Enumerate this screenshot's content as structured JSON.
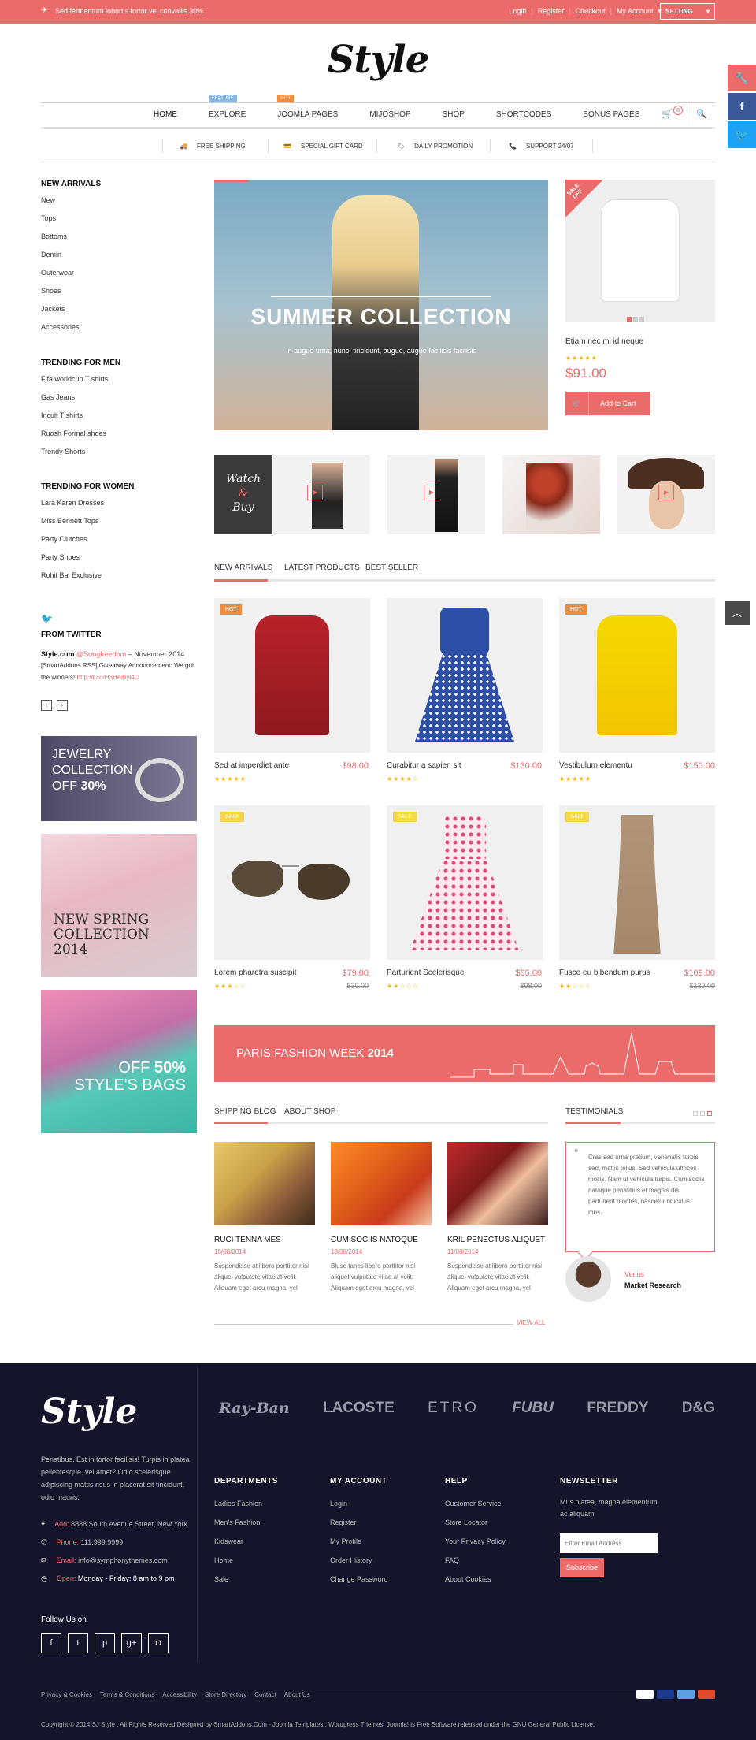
{
  "topbar": {
    "announcement": "Sed fermentum lobortis tortor vel convallis 30%",
    "links": [
      "Login",
      "Register",
      "Checkout",
      "My Account"
    ],
    "setting": "SETTING"
  },
  "logo": "Style",
  "nav": {
    "items": [
      "HOME",
      "EXPLORE",
      "JOOMLA PAGES",
      "MIJOSHOP",
      "SHOP",
      "SHORTCODES",
      "BONUS PAGES"
    ],
    "badge_feature": "FEATURE",
    "badge_hot": "HOT",
    "cart_count": "0"
  },
  "features": [
    "FREE SHIPPING",
    "SPECIAL GIFT CARD",
    "DAILY PROMOTION",
    "SUPPORT 24/07"
  ],
  "sidebar": {
    "new_arrivals_title": "NEW ARRIVALS",
    "new_arrivals": [
      "New",
      "Tops",
      "Bottoms",
      "Demin",
      "Outerwear",
      "Shoes",
      "Jackets",
      "Accessories"
    ],
    "men_title": "TRENDING FOR MEN",
    "men": [
      "Fifa worldcup T shirts",
      "Gas Jeans",
      "Incult T shirts",
      "Ruosh Formal shoes",
      "Trendy Shorts"
    ],
    "women_title": "TRENDING FOR WOMEN",
    "women": [
      "Lara Karen Dresses",
      "Miss Bennett Tops",
      "Party Clutches",
      "Party Shoes",
      "Rohit Bal Exclusive"
    ],
    "twitter_title": "FROM TWITTER",
    "tweet_user": "Style.com",
    "tweet_handle": "@Songfreedom",
    "tweet_date": " – November 2014",
    "tweet_text": "[SmartAddons RSS] Giveaway Announcement: We got the winners!",
    "tweet_link": "http://t.co/H3HeiByl4C",
    "banner1": {
      "l1": "JEWELRY",
      "l2": "COLLECTION",
      "l3": "OFF",
      "l4": "30%"
    },
    "banner2": {
      "l1": "NEW SPRING",
      "l2": "COLLECTION",
      "l3": "2014"
    },
    "banner3": {
      "l1": "OFF",
      "l2": "50%",
      "l3": "STYLE'S BAGS"
    }
  },
  "hero": {
    "title": "SUMMER COLLECTION",
    "subtitle": "In augue urna, nunc, tincidunt, augue, augue facilisis facilisis"
  },
  "sale_product": {
    "ribbon1": "SALE",
    "ribbon2": "OFF",
    "name": "Etiam nec mi id neque",
    "price": "$91.00",
    "button": "Add to Cart"
  },
  "watch_buy": {
    "l1": "Watch",
    "l2": "&",
    "l3": "Buy"
  },
  "tabs": [
    "NEW ARRIVALS",
    "LATEST PRODUCTS",
    "BEST SELLER"
  ],
  "products": [
    {
      "tag": "HOT",
      "name": "Sed at imperdiet ante",
      "price": "$98.00",
      "old": "",
      "stars": "★★★★★"
    },
    {
      "tag": "",
      "name": "Curabitur a sapien sit",
      "price": "$130.00",
      "old": "",
      "stars": "★★★★☆"
    },
    {
      "tag": "HOT",
      "name": "Vestibulum elementu",
      "price": "$150.00",
      "old": "",
      "stars": "★★★★★"
    },
    {
      "tag": "SALE",
      "name": "Lorem pharetra suscipit",
      "price": "$79.00",
      "old": "$30.00",
      "stars": "★★★☆☆"
    },
    {
      "tag": "SALE",
      "name": "Parturient Scelerisque",
      "price": "$65.00",
      "old": "$98.00",
      "stars": "★★☆☆☆"
    },
    {
      "tag": "SALE",
      "name": "Fusce eu bibendum purus",
      "price": "$109.00",
      "old": "$130.00",
      "stars": "★★☆☆☆"
    }
  ],
  "paris": {
    "text": "PARIS FASHION WEEK",
    "year": "2014"
  },
  "blog": {
    "tabs": [
      "SHIPPING BLOG",
      "ABOUT SHOP"
    ],
    "view_all": "VIEW ALL",
    "posts": [
      {
        "title": "RUCI TENNA MES",
        "date": "15/08/2014",
        "text": "Suspendisse at libero porttitor nisi aliquet vulputate vitae at velit. Aliquam eget arcu magna, vel"
      },
      {
        "title": "CUM SOCIIS NATOQUE",
        "date": "13/08/2014",
        "text": "Bluse tanes libero porttitor nisi aliquet vulputate vitae at velit. Aliquam eget arcu magna, vel"
      },
      {
        "title": "KRIL PENECTUS ALIQUET",
        "date": "11/08/2014",
        "text": "Suspendisse at libero porttitor nisi aliquet vulputate vitae at velit. Aliquam eget arcu magna, vel"
      }
    ]
  },
  "testimonials": {
    "title": "TESTIMONIALS",
    "text": "Cras sed urna pretium, venenatis turpis sed, mattis tellus. Sed vehicula ultrices mollis. Nam ut vehicula turpis. Cum sociis natoque penatibus et magnis dis parturient montes, nascetur ridiculus mus.",
    "name": "Venus",
    "role": "Market Research"
  },
  "brands": [
    "Ray-Ban",
    "LACOSTE",
    "ETRO",
    "FUBU",
    "FREDDY",
    "D&G"
  ],
  "footer": {
    "about": "Penatibus. Est in tortor facilisis! Turpis in platea pellentesque, vel amet? Odio scelerisque adipiscing mattis risus in placerat sit tincidunt, odio mauris.",
    "address_label": "Add:",
    "address": "8888 South Avenue Street, New York",
    "phone_label": "Phone:",
    "phone": "111.999.9999",
    "email_label": "Email:",
    "email": "info@symphonythemes.com",
    "open_label": "Open:",
    "open": "Monday - Friday: 8 am to 9 pm",
    "follow": "Follow Us on",
    "departments_title": "DEPARTMENTS",
    "departments": [
      "Ladies Fashion",
      "Men's Fashion",
      "Kidswear",
      "Home",
      "Sale"
    ],
    "account_title": "MY ACCOUNT",
    "account": [
      "Login",
      "Register",
      "My Profile",
      "Order History",
      "Change Password"
    ],
    "help_title": "HELP",
    "help": [
      "Customer Service",
      "Store Locator",
      "Your Privacy Policy",
      "FAQ",
      "About Cookies"
    ],
    "newsletter_title": "NEWSLETTER",
    "newsletter_text": "Mus platea, magna elementum ac aliquam",
    "email_placeholder": "Enter Email Address",
    "subscribe": "Subscribe",
    "bottom_links": [
      "Privacy & Cookies",
      "Terms & Conditions",
      "Accessibility",
      "Store Directory",
      "Contact",
      "About Us"
    ],
    "copyright": "Copyright © 2014 SJ Style . All Rights Reserved Designed by SmartAddons.Com - Joomla Templates , Wordpress Themes. Joomla! is Free Software released under the GNU General Public License."
  }
}
